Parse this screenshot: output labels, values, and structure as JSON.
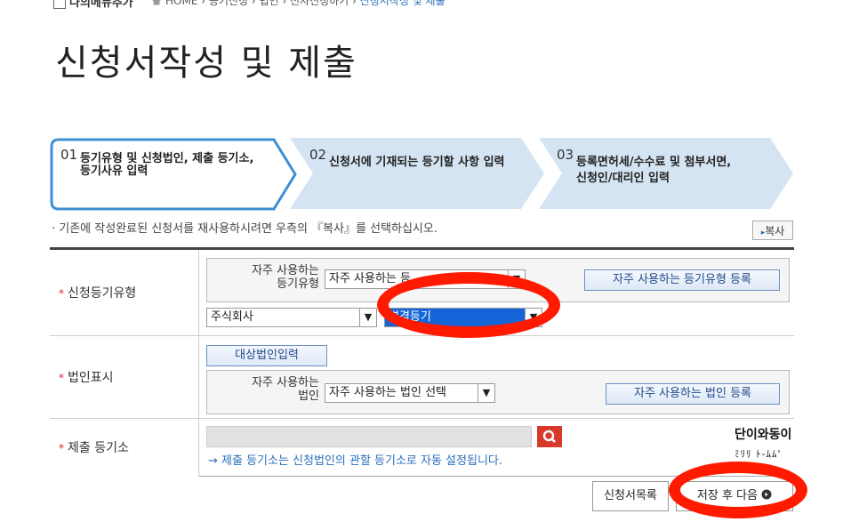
{
  "topbar": {
    "menu_add": "나의메뉴추가",
    "home": "HOME",
    "crumbs": [
      "등기신청",
      "법인",
      "전자신청하기"
    ],
    "current": "신청서작성 및 제출"
  },
  "page_title": "신청서작성 및 제출",
  "steps": [
    {
      "num": "01",
      "line1": "등기유형 및 신청법인, 제출 등기소,",
      "line2": "등기사유 입력",
      "active": true
    },
    {
      "num": "02",
      "line1": "신청서에 기재되는 등기할 사항 입력",
      "line2": "",
      "active": false
    },
    {
      "num": "03",
      "line1": "등록면허세/수수료 및 첨부서면,",
      "line2": "신청인/대리인 입력",
      "active": false
    }
  ],
  "info_text": "· 기존에 작성완료된 신청서를 재사용하시려면 우측의 『복사』를 선택하십시오.",
  "copy_button": "복사",
  "rows": {
    "type": {
      "label": "신청등기유형",
      "freq_label_1": "자주 사용하는",
      "freq_label_2": "등기유형",
      "freq_select": "자주 사용하는 등",
      "freq_button": "자주 사용하는 등기유형 등록",
      "company_select": "주식회사",
      "change_select": "변경등기"
    },
    "corp": {
      "label": "법인표시",
      "target_button": "대상법인입력",
      "freq_label_1": "자주 사용하는",
      "freq_label_2": "법인",
      "freq_select": "자주 사용하는 법인 선택",
      "freq_button": "자주 사용하는 법인 등록"
    },
    "office": {
      "label": "제출 등기소",
      "note": "→ 제출 등기소는 신청법인의 관할 등기소로 자동 설정됩니다."
    }
  },
  "buttons": {
    "list": "신청서목록",
    "save_next": "저장 후 다음"
  },
  "watermark": {
    "line1": "단이와동이",
    "line2": "ﾐﾘﾘ ﾄ-ﾑﾑ'"
  },
  "colors": {
    "active_step_border": "#3d8fd6",
    "inactive_step_fill": "#d5e4f3",
    "highlight_red": "#ff1a00",
    "selected_blue": "#1565d8",
    "link_blue": "#2a6ebb"
  }
}
